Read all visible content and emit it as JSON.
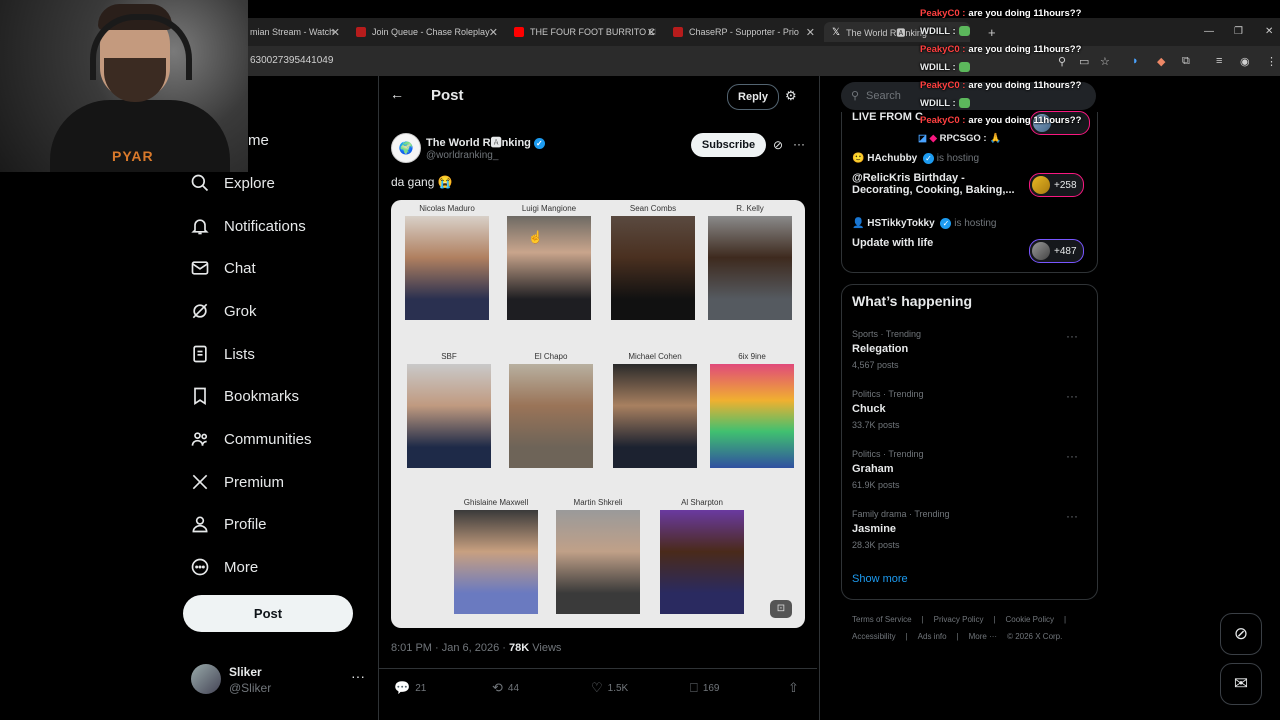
{
  "browser": {
    "tabs": [
      {
        "label": "mian Stream - Watch",
        "fav_color": "#e53935"
      },
      {
        "label": "Join Queue - Chase Roleplay",
        "fav_color": "#b71c1c"
      },
      {
        "label": "THE FOUR FOOT BURRITO CHA",
        "fav_color": "#ff0000"
      },
      {
        "label": "ChaseRP - Supporter - Prio",
        "fav_color": "#b71c1c"
      },
      {
        "label": "The World R🅰nking",
        "fav_color": "#ffffff"
      }
    ],
    "new_tab": "+",
    "url": "630027395441049"
  },
  "webcam": {
    "shirt_text": "PYAR"
  },
  "nav": {
    "items": [
      {
        "label": "me",
        "icon": "home-icon"
      },
      {
        "label": "Explore",
        "icon": "search-icon"
      },
      {
        "label": "Notifications",
        "icon": "bell-icon"
      },
      {
        "label": "Chat",
        "icon": "mail-icon"
      },
      {
        "label": "Grok",
        "icon": "grok-icon"
      },
      {
        "label": "Lists",
        "icon": "list-icon"
      },
      {
        "label": "Bookmarks",
        "icon": "bookmark-icon"
      },
      {
        "label": "Communities",
        "icon": "people-icon"
      },
      {
        "label": "Premium",
        "icon": "x-icon"
      },
      {
        "label": "Profile",
        "icon": "person-icon"
      },
      {
        "label": "More",
        "icon": "more-circle-icon"
      }
    ],
    "post_label": "Post",
    "user": {
      "name": "Sliker",
      "handle": "@Sliker"
    }
  },
  "post": {
    "header_title": "Post",
    "reply_label": "Reply",
    "author_name": "The World R🅰nking",
    "author_handle": "@worldranking_",
    "subscribe_label": "Subscribe",
    "text": "da gang 😭",
    "image_people": [
      {
        "name": "Nicolas Maduro",
        "tone": "#b08060"
      },
      {
        "name": "Luigi Mangione",
        "tone": "#5a4030"
      },
      {
        "name": "Sean Combs",
        "tone": "#4a3020"
      },
      {
        "name": "R. Kelly",
        "tone": "#3e2a1e"
      },
      {
        "name": "SBF",
        "tone": "#c09a80"
      },
      {
        "name": "El Chapo",
        "tone": "#9a7458"
      },
      {
        "name": "Michael Cohen",
        "tone": "#a88060"
      },
      {
        "name": "6ix 9ine",
        "tone": "#e04a7a"
      },
      {
        "name": "Ghislaine Maxwell",
        "tone": "#6a7ac0"
      },
      {
        "name": "Martin Shkreli",
        "tone": "#8a8a8a"
      },
      {
        "name": "Al Sharpton",
        "tone": "#6a3aa0"
      }
    ],
    "time": "8:01 PM · Jan 6, 2026 ·",
    "views_count": "78K",
    "views_label": "Views",
    "replies": "21",
    "reposts": "44",
    "likes": "1.5K",
    "bookmarks": "169"
  },
  "right": {
    "search_placeholder": "Search",
    "live": [
      {
        "title": "LIVE FROM C"
      },
      {
        "host": "HAchubby",
        "host_label": "is hosting",
        "title": "@RelicKris Birthday - Decorating, Cooking, Baking,...",
        "count": "+258"
      },
      {
        "host": "HSTikkyTokky",
        "host_label": "is hosting",
        "title": "Update with life",
        "count": "+487"
      }
    ],
    "whats_happening": "What’s happening",
    "trends": [
      {
        "category": "Sports · Trending",
        "name": "Relegation",
        "count": "4,567 posts"
      },
      {
        "category": "Politics · Trending",
        "name": "Chuck",
        "count": "33.7K posts"
      },
      {
        "category": "Politics · Trending",
        "name": "Graham",
        "count": "61.9K posts"
      },
      {
        "category": "Family drama · Trending",
        "name": "Jasmine",
        "count": "28.3K posts"
      }
    ],
    "show_more": "Show more",
    "footer_row1": [
      "Terms of Service",
      "|",
      "Privacy Policy",
      "|",
      "Cookie Policy",
      "|"
    ],
    "footer_row2": [
      "Accessibility",
      "|",
      "Ads info",
      "|",
      "More ···",
      "© 2026 X Corp."
    ]
  },
  "chat": [
    {
      "user": "PeakyC0 :",
      "msg": "are you doing 11hours??",
      "color": "#ff4040"
    },
    {
      "user": "WDILL :",
      "msg": "",
      "color": "#ffffff",
      "emote": true
    },
    {
      "user": "PeakyC0 :",
      "msg": "are you doing 11hours??",
      "color": "#ff4040"
    },
    {
      "user": "WDILL :",
      "msg": "",
      "color": "#ffffff",
      "emote": true
    },
    {
      "user": "PeakyC0 :",
      "msg": "are you doing 11hours??",
      "color": "#ff4040"
    },
    {
      "user": "WDILL :",
      "msg": "",
      "color": "#ffffff",
      "emote": true
    },
    {
      "user": "PeakyC0 :",
      "msg": "are you doing 11hours??",
      "color": "#ff4040"
    },
    {
      "user": "RPCSGO :",
      "msg": "🙏",
      "color": "#ffffff"
    }
  ]
}
